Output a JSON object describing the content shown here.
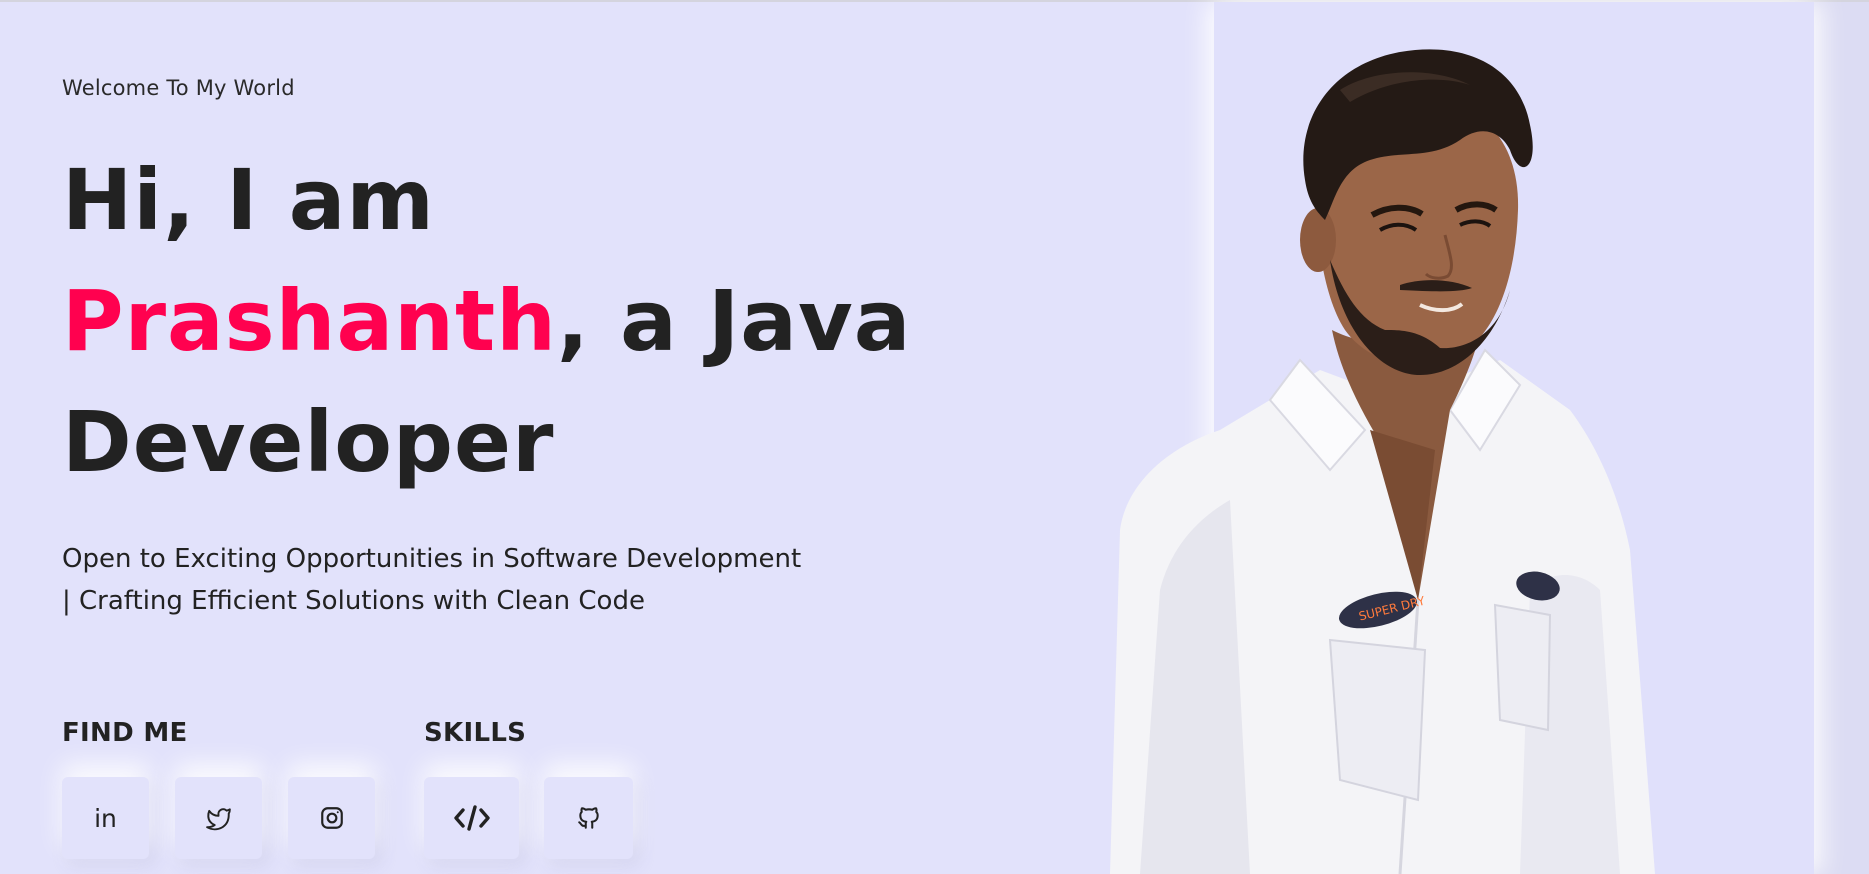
{
  "hero": {
    "welcome": "Welcome To My World",
    "line1": "Hi, I am",
    "name": "Prashanth",
    "line2_rest": ", a Java",
    "line3": "Developer",
    "tagline_line1": "Open to Exciting Opportunities in Software Development",
    "tagline_line2": "| Crafting Efficient Solutions with Clean Code"
  },
  "find_me": {
    "label": "FIND ME",
    "icons": [
      "linkedin-icon",
      "twitter-icon",
      "instagram-icon"
    ],
    "linkedin_text": "in"
  },
  "skills": {
    "label": "SKILLS",
    "icons": [
      "code-icon",
      "github-icon"
    ]
  },
  "colors": {
    "background": "#e2e2fb",
    "accent": "#ff014f",
    "text": "#222222"
  }
}
